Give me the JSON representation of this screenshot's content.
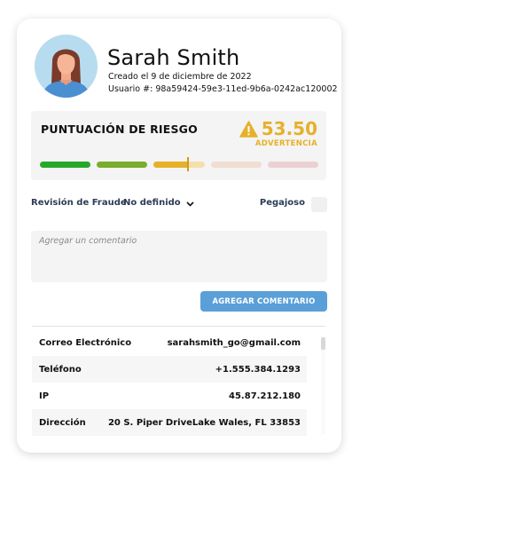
{
  "profile": {
    "name": "Sarah Smith",
    "created": "Creado el 9 de diciembre de 2022",
    "user_id_label": "Usuario #:",
    "user_id": "98a59424-59e3-11ed-9b6a-0242ac120002",
    "avatar_icon": "user-avatar-icon"
  },
  "risk": {
    "title": "PUNTUACIÓN DE RIESGO",
    "score": "53.50",
    "level": "ADVERTENCIA",
    "score_value": 53.5,
    "icon": "warning-triangle-icon",
    "accent_color": "#e6b02a",
    "segment_colors": [
      "#26a92a",
      "#79ad2b",
      "#e6b02a",
      "#f0ddd3",
      "#ecd0d2"
    ]
  },
  "fraud": {
    "label": "Revisión de Fraude",
    "selected": "No definido",
    "sticky_label": "Pegajoso",
    "sticky_checked": false
  },
  "comment": {
    "placeholder": "Agregar un comentario",
    "value": "",
    "button_label": "AGREGAR COMENTARIO",
    "button_color": "#5b9fd8"
  },
  "details": [
    {
      "key": "Correo Electrónico",
      "value": "sarahsmith_go@gmail.com"
    },
    {
      "key": "Teléfono",
      "value": "+1.555.384.1293"
    },
    {
      "key": "IP",
      "value": "45.87.212.180"
    },
    {
      "key": "Dirección",
      "value": "20 S. Piper DriveLake Wales, FL 33853"
    }
  ]
}
